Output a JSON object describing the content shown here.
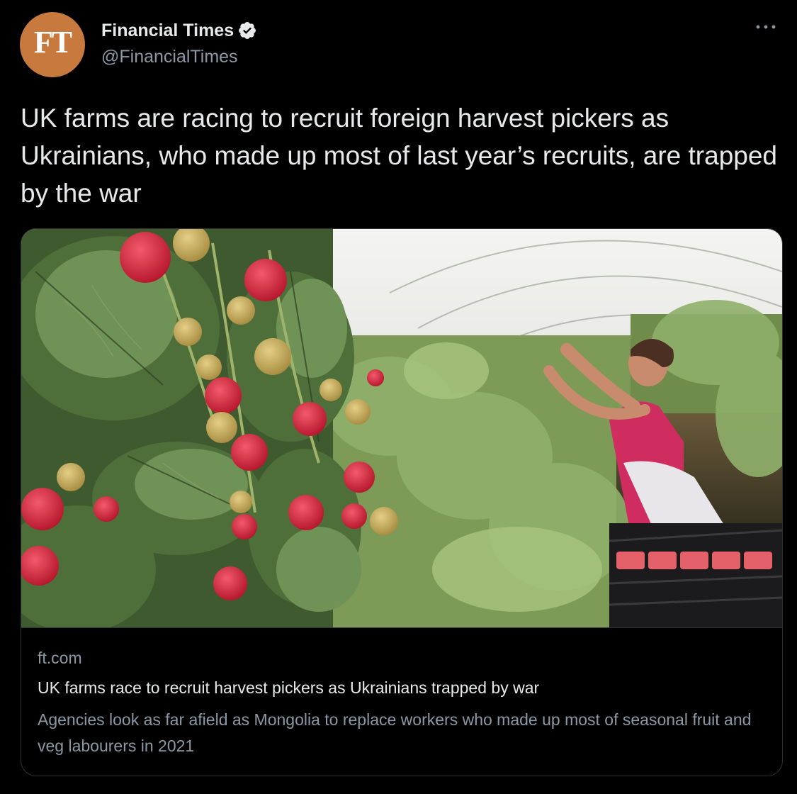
{
  "author": {
    "avatar_text": "FT",
    "avatar_color": "#c87a3e",
    "display_name": "Financial Times",
    "handle": "@FinancialTimes",
    "verified": true,
    "verified_icon": "verified-badge-icon"
  },
  "menu": {
    "icon": "more-horizontal-icon"
  },
  "tweet": {
    "text": "UK farms are racing to recruit foreign harvest pickers as Ukrainians, who made up most of last year’s recruits, are trapped by the war"
  },
  "card": {
    "image_icon": "raspberry-harvest-photo",
    "domain": "ft.com",
    "title": "UK farms race to recruit harvest pickers as Ukrainians trapped by war",
    "description": "Agencies look as far afield as Mongolia to replace workers who made up most of seasonal fruit and veg labourers in 2021"
  },
  "colors": {
    "background": "#000000",
    "primary_text": "#e7e9ea",
    "secondary_text": "#8b98a5",
    "border": "#2f3336"
  }
}
